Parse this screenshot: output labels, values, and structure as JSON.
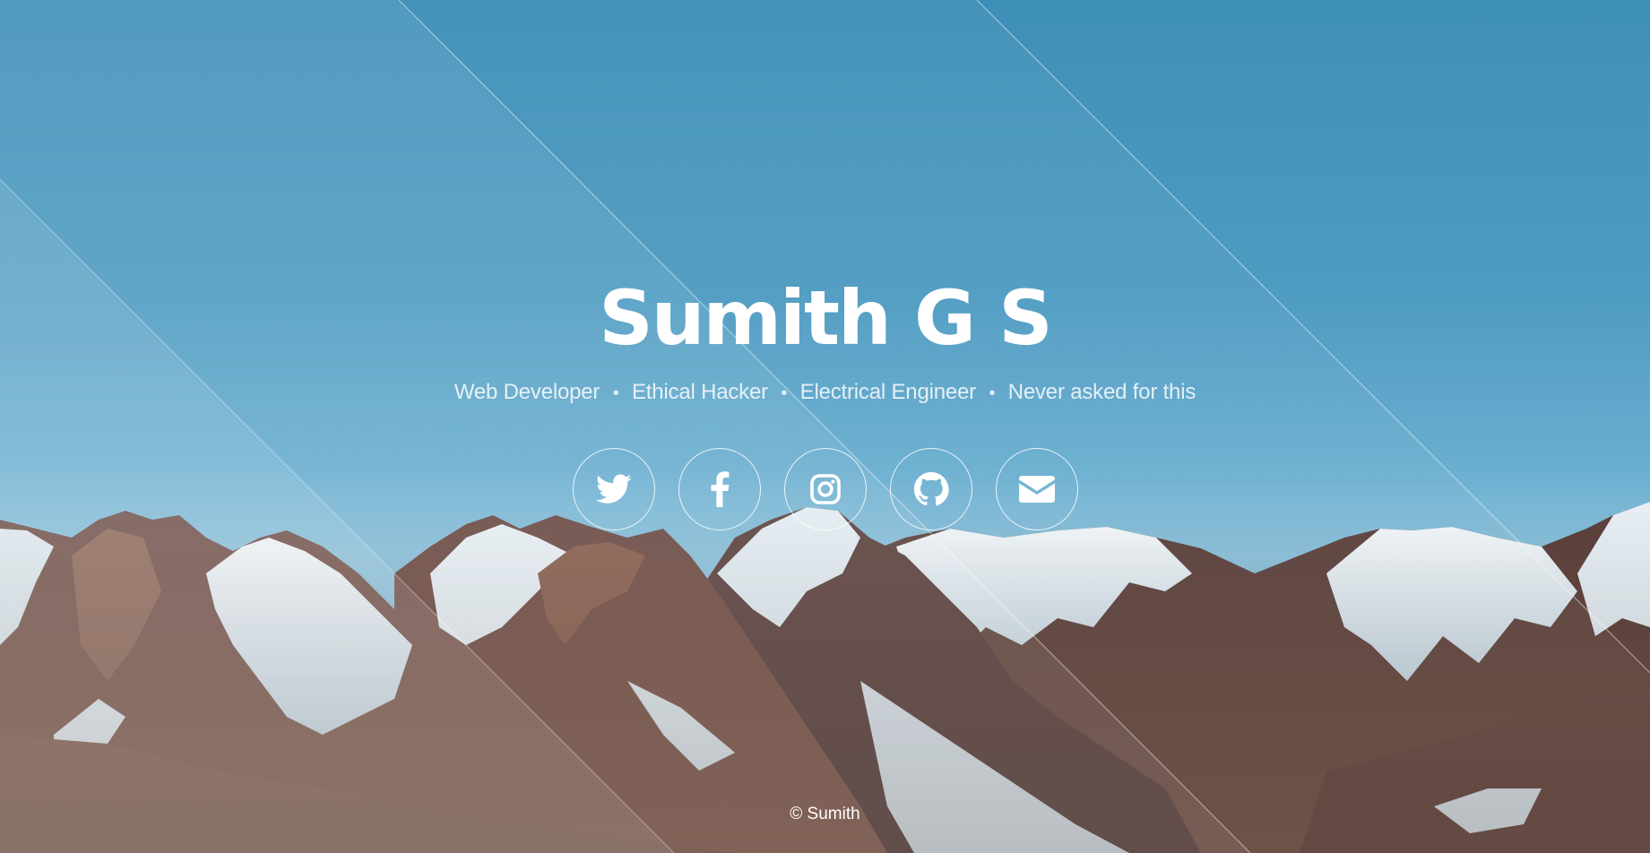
{
  "hero": {
    "name": "Sumith G S",
    "roles": [
      "Web Developer",
      "Ethical Hacker",
      "Electrical Engineer",
      "Never asked for this"
    ],
    "separator": "•"
  },
  "socials": [
    {
      "icon": "twitter-icon"
    },
    {
      "icon": "facebook-icon"
    },
    {
      "icon": "instagram-icon"
    },
    {
      "icon": "github-icon"
    },
    {
      "icon": "envelope-icon"
    }
  ],
  "footer": {
    "copyright": "© Sumith"
  },
  "colors": {
    "sky": "#3e8fb8",
    "text": "#ffffff"
  }
}
